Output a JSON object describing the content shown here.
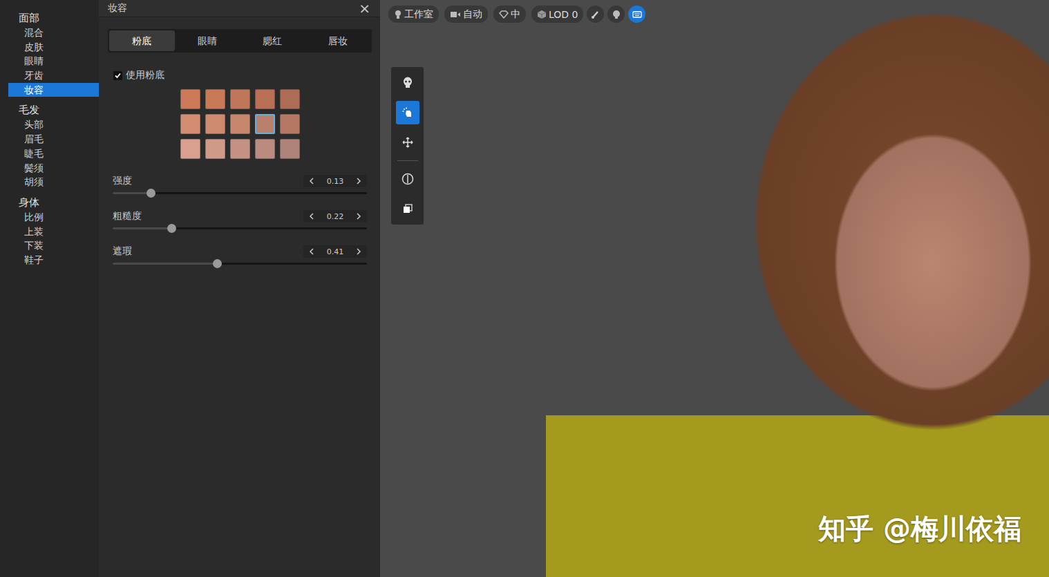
{
  "sidebar": {
    "groups": [
      {
        "title": "面部",
        "items": [
          {
            "label": "混合",
            "selected": false
          },
          {
            "label": "皮肤",
            "selected": false
          },
          {
            "label": "眼睛",
            "selected": false
          },
          {
            "label": "牙齿",
            "selected": false
          },
          {
            "label": "妆容",
            "selected": true
          }
        ]
      },
      {
        "title": "毛发",
        "items": [
          {
            "label": "头部",
            "selected": false
          },
          {
            "label": "眉毛",
            "selected": false
          },
          {
            "label": "睫毛",
            "selected": false
          },
          {
            "label": "鬓须",
            "selected": false
          },
          {
            "label": "胡须",
            "selected": false
          }
        ]
      },
      {
        "title": "身体",
        "items": [
          {
            "label": "比例",
            "selected": false
          },
          {
            "label": "上装",
            "selected": false
          },
          {
            "label": "下装",
            "selected": false
          },
          {
            "label": "鞋子",
            "selected": false
          }
        ]
      }
    ]
  },
  "panel": {
    "title": "妆容",
    "close": "×",
    "tabs": [
      {
        "label": "粉底",
        "selected": true
      },
      {
        "label": "眼睛",
        "selected": false
      },
      {
        "label": "腮红",
        "selected": false
      },
      {
        "label": "唇妆",
        "selected": false
      }
    ],
    "checkbox": {
      "label": "使用粉底",
      "checked": true
    },
    "swatches": [
      {
        "color": "#cd7a58",
        "selected": false
      },
      {
        "color": "#c87a58",
        "selected": false
      },
      {
        "color": "#c07658",
        "selected": false
      },
      {
        "color": "#b86f55",
        "selected": false
      },
      {
        "color": "#ae6b55",
        "selected": false
      },
      {
        "color": "#d38e72",
        "selected": false
      },
      {
        "color": "#cd8a6e",
        "selected": false
      },
      {
        "color": "#c5866c",
        "selected": false
      },
      {
        "color": "#b9806b",
        "selected": true
      },
      {
        "color": "#b57865",
        "selected": false
      },
      {
        "color": "#d9a090",
        "selected": false
      },
      {
        "color": "#cf9a88",
        "selected": false
      },
      {
        "color": "#c59184",
        "selected": false
      },
      {
        "color": "#bb8b80",
        "selected": false
      },
      {
        "color": "#b08378",
        "selected": false
      }
    ],
    "sliders": [
      {
        "label": "强度",
        "reading": "0.13",
        "level": 0.15
      },
      {
        "label": "粗糙度",
        "reading": "0.22",
        "level": 0.23
      },
      {
        "label": "遮瑕",
        "reading": "0.41",
        "level": 0.41
      }
    ]
  },
  "viewport": {
    "pills": [
      {
        "label": "工作室"
      },
      {
        "label": "自动"
      },
      {
        "label": "中"
      },
      {
        "label": "LOD 0"
      }
    ],
    "buttons": [
      {
        "selected": false
      },
      {
        "selected": false
      },
      {
        "selected": true
      }
    ],
    "tools": [
      {
        "selected": false
      },
      {
        "selected": true
      },
      {
        "selected": false
      },
      {
        "selected": false
      },
      {
        "selected": false
      }
    ],
    "watermark": "知乎 @梅川依福"
  }
}
